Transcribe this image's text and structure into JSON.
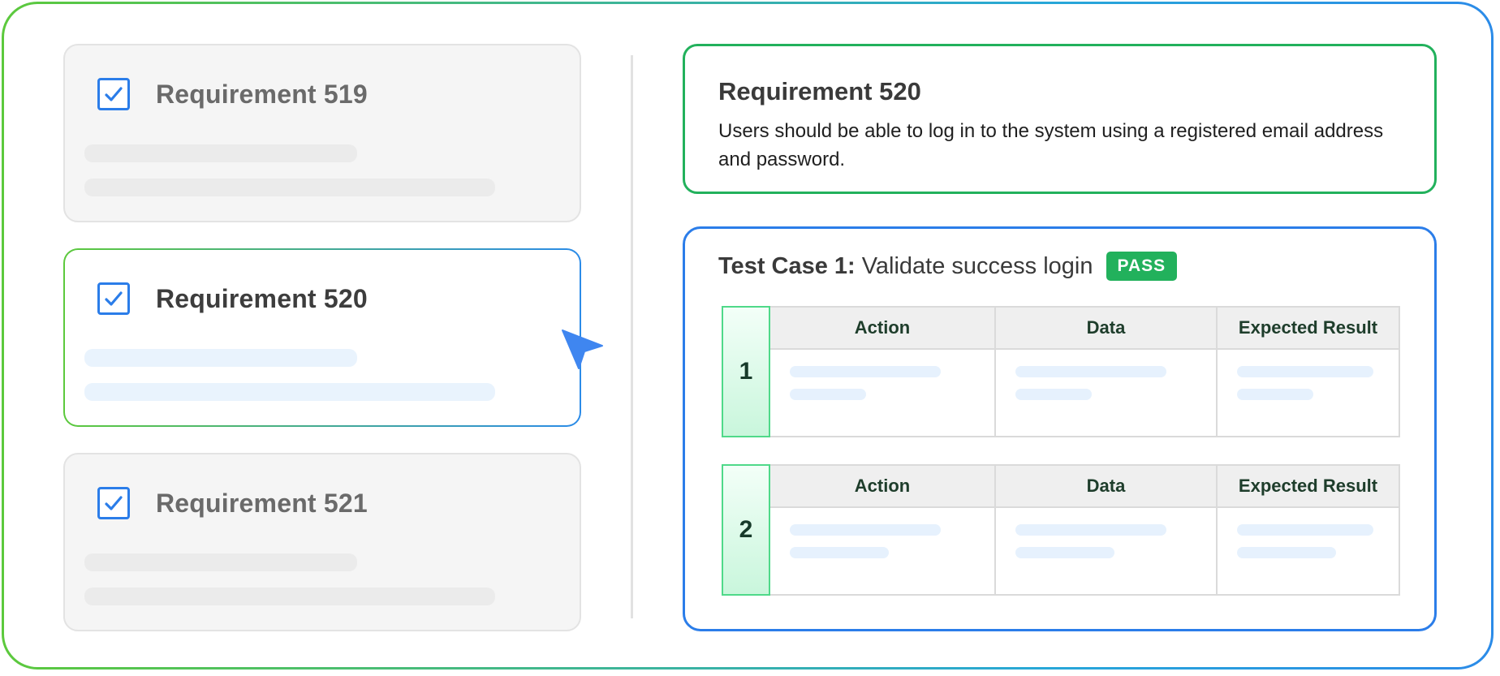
{
  "requirements": [
    {
      "title": "Requirement 519",
      "checked": true,
      "state": "inactive"
    },
    {
      "title": "Requirement 520",
      "checked": true,
      "state": "active"
    },
    {
      "title": "Requirement 521",
      "checked": true,
      "state": "inactive"
    }
  ],
  "detail": {
    "title": "Requirement 520",
    "description": "Users should be able to log in to the system using a registered email address and password."
  },
  "test_case": {
    "label": "Test Case 1:",
    "name": "Validate success login",
    "status": "PASS",
    "steps": [
      {
        "number": "1",
        "columns": [
          "Action",
          "Data",
          "Expected Result"
        ]
      },
      {
        "number": "2",
        "columns": [
          "Action",
          "Data",
          "Expected Result"
        ]
      }
    ]
  },
  "colors": {
    "accent_blue": "#2b7de9",
    "accent_green": "#22b15c",
    "pass_badge": "#22b15c"
  },
  "icons": {
    "checkbox": "checked-checkbox-icon",
    "cursor": "pointer-cursor-icon"
  }
}
